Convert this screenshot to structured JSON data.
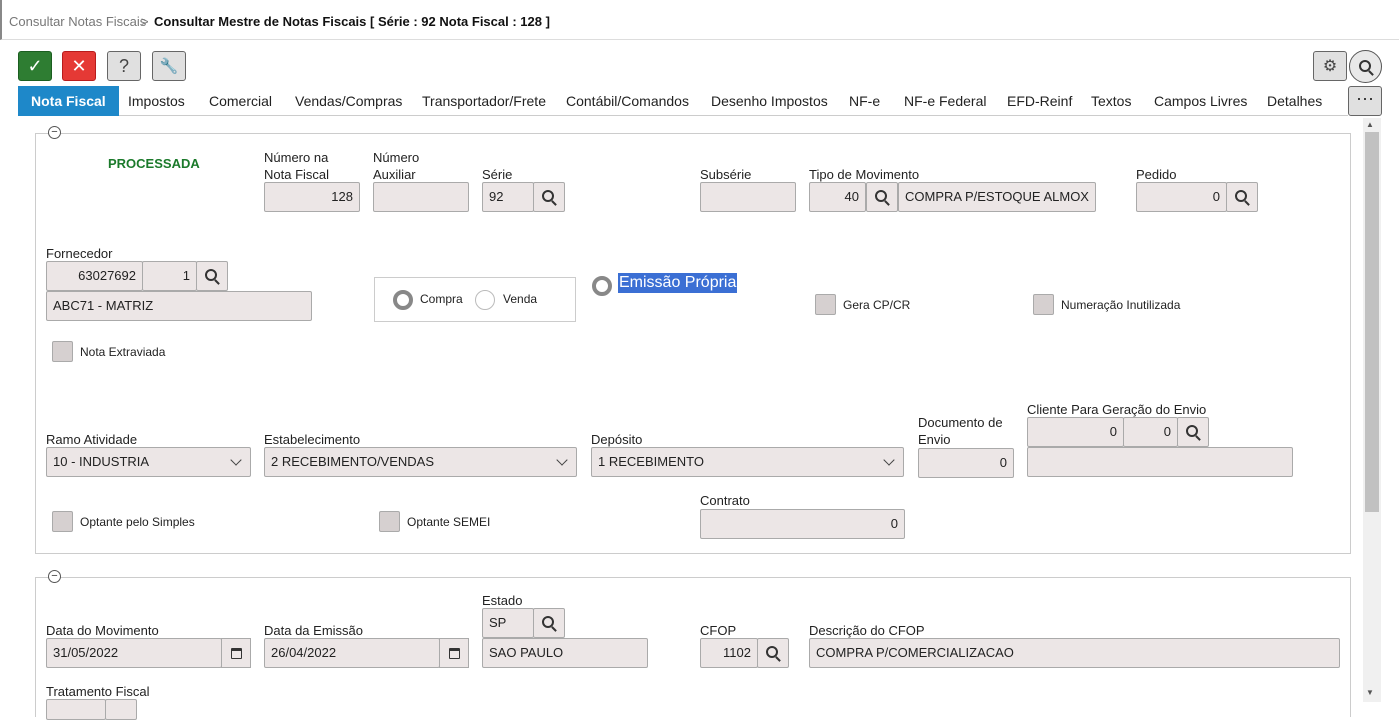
{
  "breadcrumb": {
    "parent": "Consultar Notas Fiscais",
    "sep": ">",
    "current": "Consultar Mestre de Notas Fiscais [ Série : 92 Nota Fiscal : 128 ]"
  },
  "toolbar": {
    "help": "?",
    "more": "···"
  },
  "tabs": [
    "Nota Fiscal",
    "Impostos",
    "Comercial",
    "Vendas/Compras",
    "Transportador/Frete",
    "Contábil/Comandos",
    "Desenho Impostos",
    "NF-e",
    "NF-e Federal",
    "EFD-Reinf",
    "Textos",
    "Campos Livres",
    "Detalhes"
  ],
  "status": "PROCESSADA",
  "fields": {
    "numero_label1": "Número na",
    "numero_label2": "Nota Fiscal",
    "numero": "128",
    "aux_label1": "Número",
    "aux_label2": "Auxiliar",
    "aux": "",
    "serie_label": "Série",
    "serie": "92",
    "subserie_label": "Subsérie",
    "subserie": "",
    "tipo_label": "Tipo de Movimento",
    "tipo_cod": "40",
    "tipo_desc": "COMPRA P/ESTOQUE ALMOX",
    "pedido_label": "Pedido",
    "pedido": "0",
    "fornecedor_label": "Fornecedor",
    "forn_cod": "63027692",
    "forn_filial": "1",
    "forn_nome": "ABC71 - MATRIZ",
    "compra": "Compra",
    "venda": "Venda",
    "emissao_propria": "Emissão Própria",
    "gera_cp": "Gera CP/CR",
    "num_inutilizada": "Numeração Inutilizada",
    "nota_extraviada": "Nota Extraviada",
    "ramo_label": "Ramo Atividade",
    "ramo": "10 - INDUSTRIA",
    "estab_label": "Estabelecimento",
    "estab": "2 RECEBIMENTO/VENDAS",
    "deposito_label": "Depósito",
    "deposito": "1 RECEBIMENTO",
    "doc_label1": "Documento de",
    "doc_label2": "Envio",
    "doc": "0",
    "cliente_label": "Cliente Para Geração do Envio",
    "cliente_cod": "0",
    "cliente_filial": "0",
    "cliente_nome": "",
    "optante_simples": "Optante pelo Simples",
    "optante_semei": "Optante SEMEI",
    "contrato_label": "Contrato",
    "contrato": "0"
  },
  "section2": {
    "data_mov_label": "Data do Movimento",
    "data_mov": "31/05/2022",
    "data_em_label": "Data da Emissão",
    "data_em": "26/04/2022",
    "estado_label": "Estado",
    "estado": "SP",
    "estado_nome": "SAO PAULO",
    "cfop_label": "CFOP",
    "cfop": "1102",
    "desc_cfop_label": "Descrição do CFOP",
    "desc_cfop": "COMPRA P/COMERCIALIZACAO",
    "trat_label": "Tratamento Fiscal"
  }
}
